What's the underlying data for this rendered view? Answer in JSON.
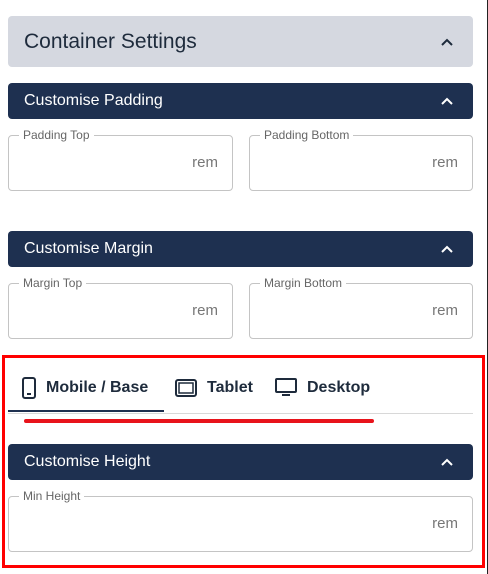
{
  "container": {
    "title": "Container Settings",
    "chevron": "chevron-up-icon"
  },
  "padding": {
    "title": "Customise Padding",
    "top": {
      "label": "Padding Top",
      "value": "",
      "unit": "rem"
    },
    "bottom": {
      "label": "Padding Bottom",
      "value": "",
      "unit": "rem"
    }
  },
  "margin": {
    "title": "Customise Margin",
    "top": {
      "label": "Margin Top",
      "value": "",
      "unit": "rem"
    },
    "bottom": {
      "label": "Margin Bottom",
      "value": "",
      "unit": "rem"
    }
  },
  "tabs": [
    {
      "label": "Mobile / Base",
      "icon": "mobile-icon",
      "active": true
    },
    {
      "label": "Tablet",
      "icon": "tablet-icon",
      "active": false
    },
    {
      "label": "Desktop",
      "icon": "desktop-icon",
      "active": false
    }
  ],
  "height": {
    "title": "Customise Height",
    "min": {
      "label": "Min Height",
      "value": "",
      "unit": "rem"
    }
  },
  "colors": {
    "section_bar": "#1e3050",
    "container_header": "#d5d8e0",
    "highlight": "#ff0000"
  }
}
